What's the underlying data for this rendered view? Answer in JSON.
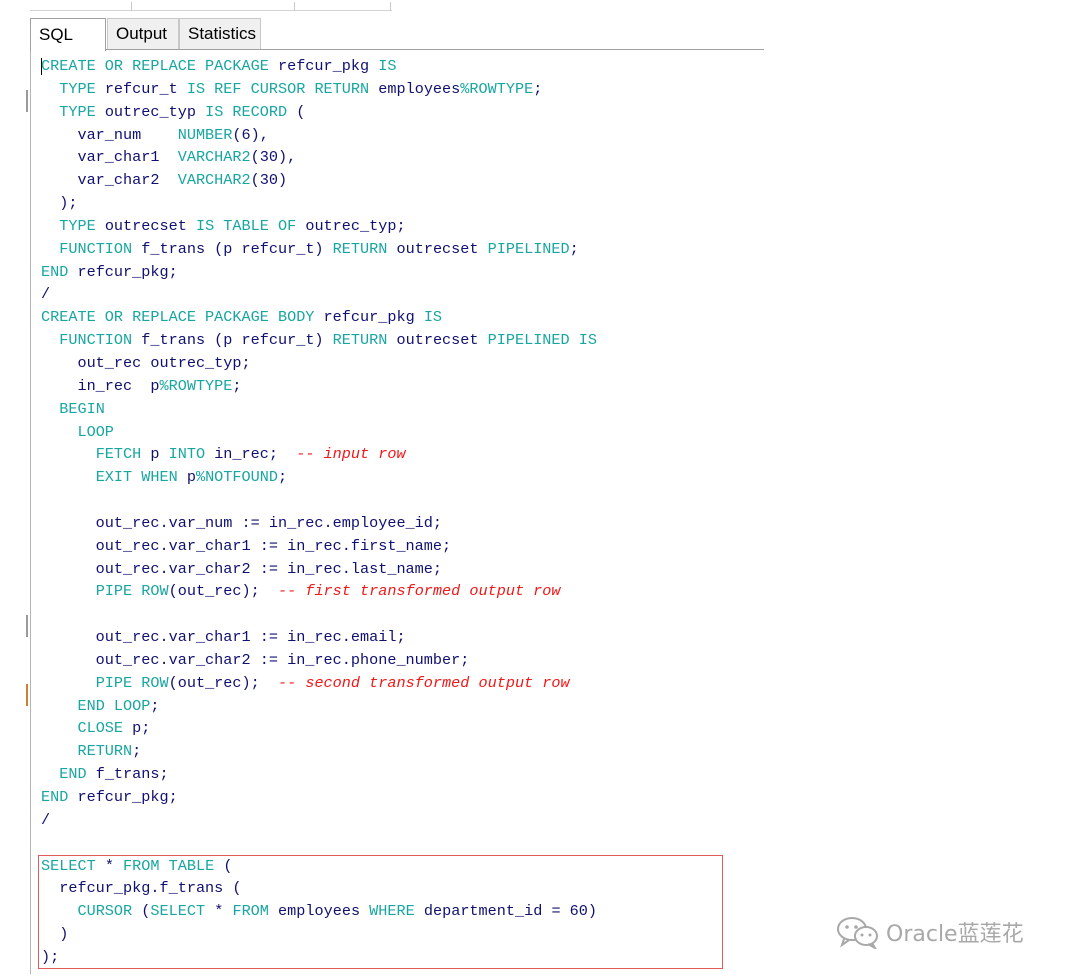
{
  "tabs": [
    {
      "label": "SQL",
      "active": true
    },
    {
      "label": "Output",
      "active": false
    },
    {
      "label": "Statistics",
      "active": false
    }
  ],
  "colors": {
    "keyword": "#18a6a0",
    "identifier": "#101070",
    "comment": "#f01818",
    "highlight_box": "#e25b5b"
  },
  "code_lines": [
    [
      [
        "k",
        "CREATE OR REPLACE PACKAGE "
      ],
      [
        "x",
        "refcur_pkg "
      ],
      [
        "k",
        "IS"
      ]
    ],
    [
      [
        "x",
        "  "
      ],
      [
        "k",
        "TYPE "
      ],
      [
        "x",
        "refcur_t "
      ],
      [
        "k",
        "IS REF CURSOR RETURN "
      ],
      [
        "x",
        "employees"
      ],
      [
        "k",
        "%ROWTYPE"
      ],
      [
        "x",
        ";"
      ]
    ],
    [
      [
        "x",
        "  "
      ],
      [
        "k",
        "TYPE "
      ],
      [
        "x",
        "outrec_typ "
      ],
      [
        "k",
        "IS RECORD "
      ],
      [
        "x",
        "("
      ]
    ],
    [
      [
        "x",
        "    var_num    "
      ],
      [
        "k",
        "NUMBER"
      ],
      [
        "x",
        "(6),"
      ]
    ],
    [
      [
        "x",
        "    var_char1  "
      ],
      [
        "k",
        "VARCHAR2"
      ],
      [
        "x",
        "(30),"
      ]
    ],
    [
      [
        "x",
        "    var_char2  "
      ],
      [
        "k",
        "VARCHAR2"
      ],
      [
        "x",
        "(30)"
      ]
    ],
    [
      [
        "x",
        "  );"
      ]
    ],
    [
      [
        "x",
        "  "
      ],
      [
        "k",
        "TYPE "
      ],
      [
        "x",
        "outrecset "
      ],
      [
        "k",
        "IS TABLE OF "
      ],
      [
        "x",
        "outrec_typ;"
      ]
    ],
    [
      [
        "x",
        "  "
      ],
      [
        "k",
        "FUNCTION "
      ],
      [
        "x",
        "f_trans (p refcur_t) "
      ],
      [
        "k",
        "RETURN "
      ],
      [
        "x",
        "outrecset "
      ],
      [
        "k",
        "PIPELINED"
      ],
      [
        "x",
        ";"
      ]
    ],
    [
      [
        "k",
        "END "
      ],
      [
        "x",
        "refcur_pkg;"
      ]
    ],
    [
      [
        "x",
        "/"
      ]
    ],
    [
      [
        "k",
        "CREATE OR REPLACE PACKAGE BODY "
      ],
      [
        "x",
        "refcur_pkg "
      ],
      [
        "k",
        "IS"
      ]
    ],
    [
      [
        "x",
        "  "
      ],
      [
        "k",
        "FUNCTION "
      ],
      [
        "x",
        "f_trans (p refcur_t) "
      ],
      [
        "k",
        "RETURN "
      ],
      [
        "x",
        "outrecset "
      ],
      [
        "k",
        "PIPELINED IS"
      ]
    ],
    [
      [
        "x",
        "    out_rec outrec_typ;"
      ]
    ],
    [
      [
        "x",
        "    in_rec  p"
      ],
      [
        "k",
        "%ROWTYPE"
      ],
      [
        "x",
        ";"
      ]
    ],
    [
      [
        "x",
        "  "
      ],
      [
        "k",
        "BEGIN"
      ]
    ],
    [
      [
        "x",
        "    "
      ],
      [
        "k",
        "LOOP"
      ]
    ],
    [
      [
        "x",
        "      "
      ],
      [
        "k",
        "FETCH "
      ],
      [
        "x",
        "p "
      ],
      [
        "k",
        "INTO "
      ],
      [
        "x",
        "in_rec;  "
      ],
      [
        "c",
        "-- input row"
      ]
    ],
    [
      [
        "x",
        "      "
      ],
      [
        "k",
        "EXIT WHEN "
      ],
      [
        "x",
        "p"
      ],
      [
        "k",
        "%NOTFOUND"
      ],
      [
        "x",
        ";"
      ]
    ],
    [],
    [
      [
        "x",
        "      out_rec.var_num := in_rec.employee_id;"
      ]
    ],
    [
      [
        "x",
        "      out_rec.var_char1 := in_rec.first_name;"
      ]
    ],
    [
      [
        "x",
        "      out_rec.var_char2 := in_rec.last_name;"
      ]
    ],
    [
      [
        "x",
        "      "
      ],
      [
        "k",
        "PIPE ROW"
      ],
      [
        "x",
        "(out_rec);  "
      ],
      [
        "c",
        "-- first transformed output row"
      ]
    ],
    [],
    [
      [
        "x",
        "      out_rec.var_char1 := in_rec.email;"
      ]
    ],
    [
      [
        "x",
        "      out_rec.var_char2 := in_rec.phone_number;"
      ]
    ],
    [
      [
        "x",
        "      "
      ],
      [
        "k",
        "PIPE ROW"
      ],
      [
        "x",
        "(out_rec);  "
      ],
      [
        "c",
        "-- second transformed output row"
      ]
    ],
    [
      [
        "x",
        "    "
      ],
      [
        "k",
        "END LOOP"
      ],
      [
        "x",
        ";"
      ]
    ],
    [
      [
        "x",
        "    "
      ],
      [
        "k",
        "CLOSE "
      ],
      [
        "x",
        "p;"
      ]
    ],
    [
      [
        "x",
        "    "
      ],
      [
        "k",
        "RETURN"
      ],
      [
        "x",
        ";"
      ]
    ],
    [
      [
        "x",
        "  "
      ],
      [
        "k",
        "END "
      ],
      [
        "x",
        "f_trans;"
      ]
    ],
    [
      [
        "k",
        "END "
      ],
      [
        "x",
        "refcur_pkg;"
      ]
    ],
    [
      [
        "x",
        "/"
      ]
    ],
    [],
    [
      [
        "k",
        "SELECT "
      ],
      [
        "x",
        "* "
      ],
      [
        "k",
        "FROM TABLE "
      ],
      [
        "x",
        "("
      ]
    ],
    [
      [
        "x",
        "  refcur_pkg.f_trans ("
      ]
    ],
    [
      [
        "x",
        "    "
      ],
      [
        "k",
        "CURSOR "
      ],
      [
        "x",
        "("
      ],
      [
        "k",
        "SELECT "
      ],
      [
        "x",
        "* "
      ],
      [
        "k",
        "FROM "
      ],
      [
        "x",
        "employees "
      ],
      [
        "k",
        "WHERE "
      ],
      [
        "x",
        "department_id = 60)"
      ]
    ],
    [
      [
        "x",
        "  )"
      ]
    ],
    [
      [
        "x",
        ");"
      ]
    ]
  ],
  "watermark": {
    "icon": "wechat-icon",
    "text": "Oracle蓝莲花"
  }
}
